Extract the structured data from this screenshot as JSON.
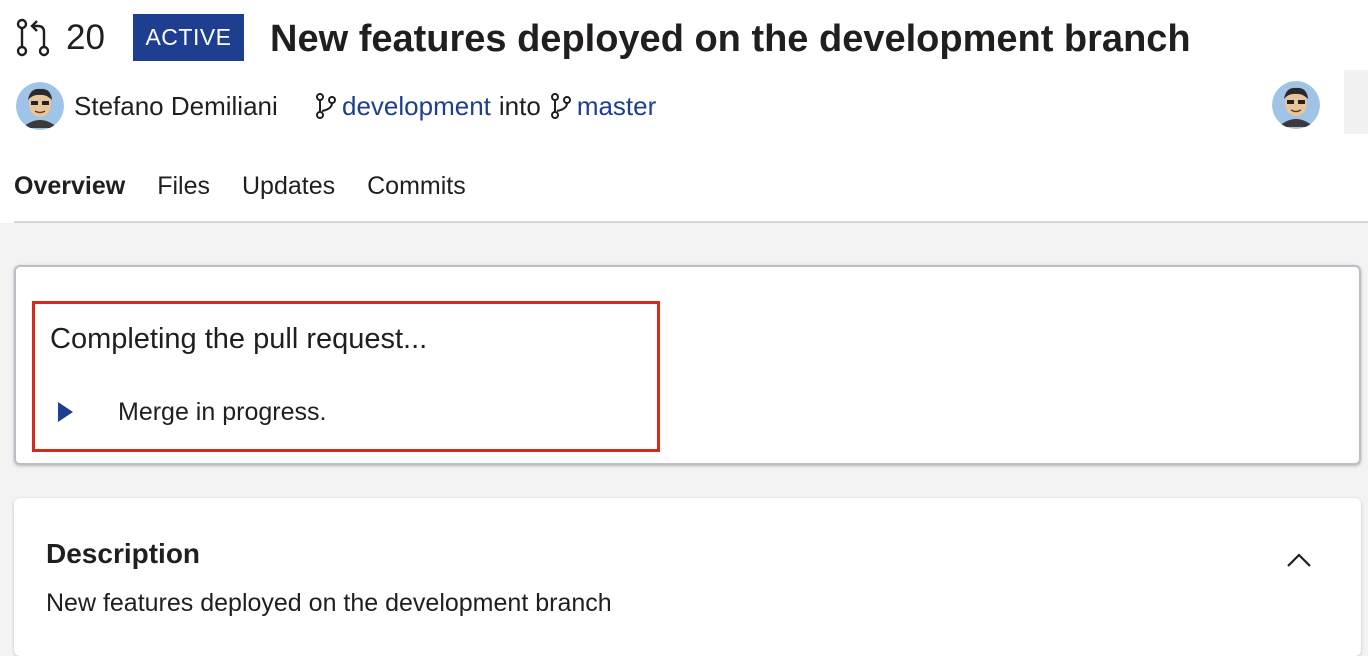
{
  "header": {
    "pr_number": "20",
    "status": "ACTIVE",
    "title": "New features deployed on the development branch",
    "author": "Stefano Demiliani",
    "source_branch": "development",
    "into_text": "into",
    "target_branch": "master"
  },
  "tabs": [
    {
      "label": "Overview",
      "active": true
    },
    {
      "label": "Files",
      "active": false
    },
    {
      "label": "Updates",
      "active": false
    },
    {
      "label": "Commits",
      "active": false
    }
  ],
  "progress": {
    "message": "Completing the pull request...",
    "step": "Merge in progress."
  },
  "description": {
    "heading": "Description",
    "body": "New features deployed on the development branch"
  },
  "icons": {
    "pull_request": "pull-request-icon",
    "branch": "branch-icon",
    "expand": "caret-right-icon",
    "collapse": "chevron-up-icon"
  },
  "colors": {
    "accent": "#1e3f8f",
    "highlight": "#d4291c",
    "background": "#f3f3f3"
  }
}
